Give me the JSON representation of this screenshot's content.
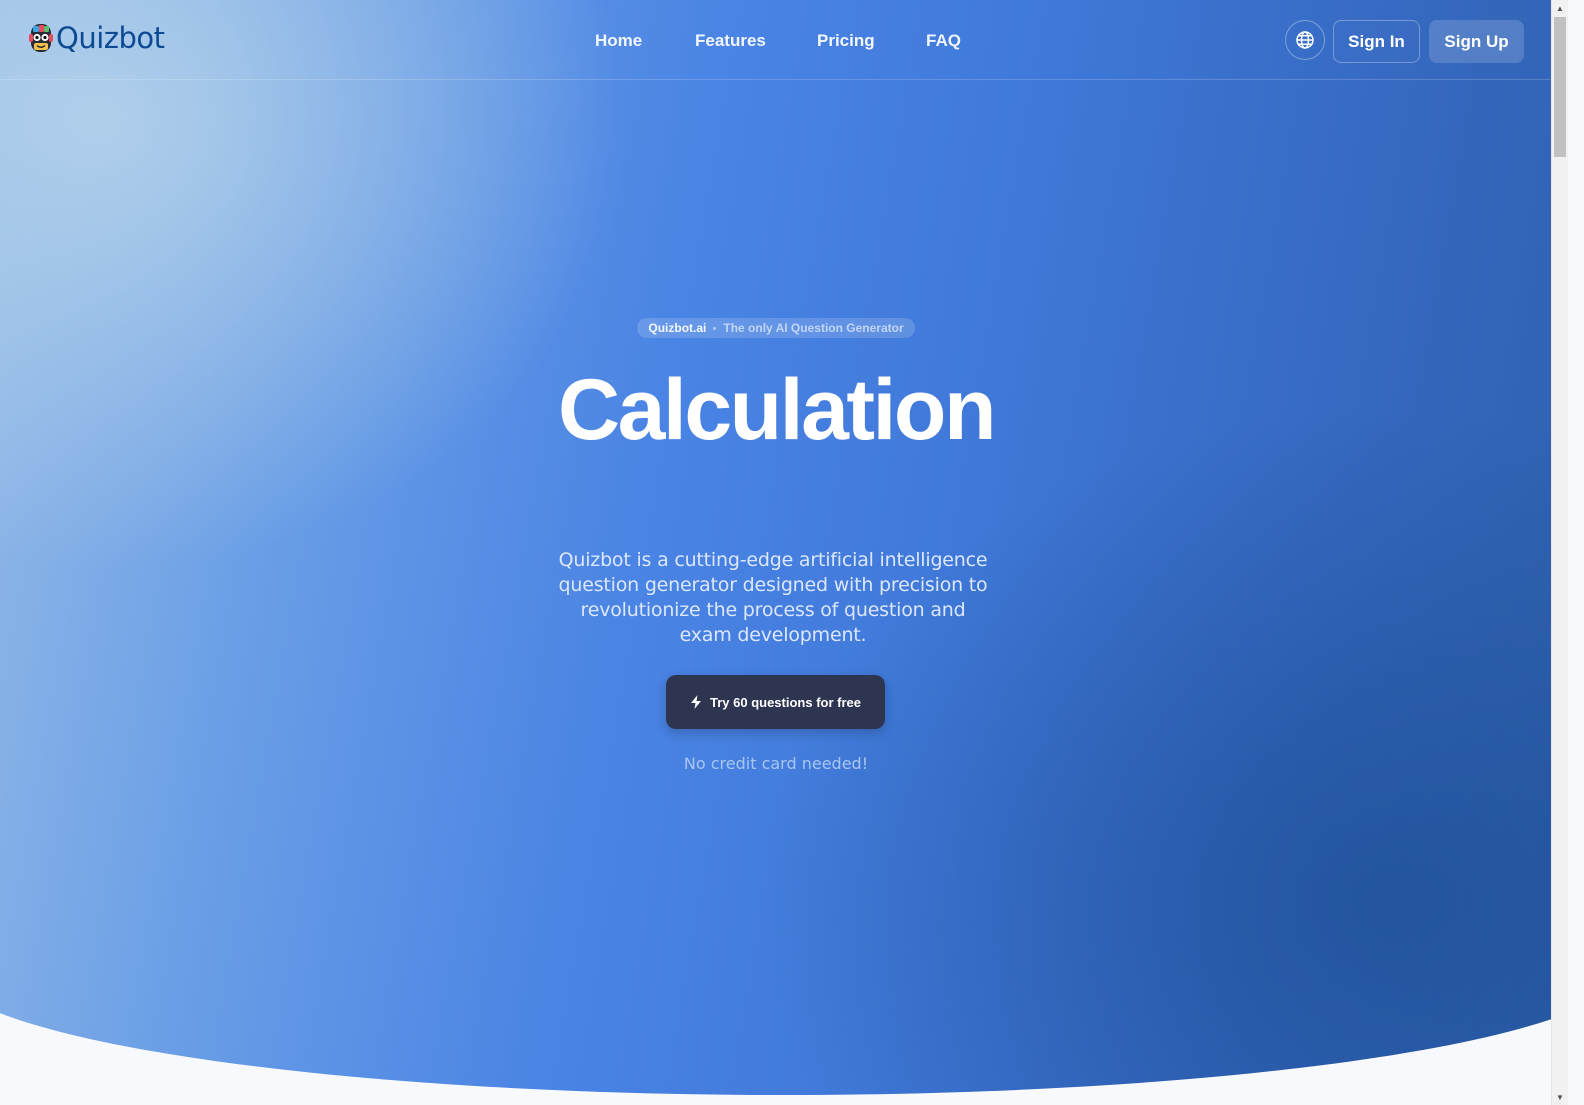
{
  "nav": {
    "logo_text": "Quizbot",
    "links": [
      {
        "label": "Home"
      },
      {
        "label": "Features"
      },
      {
        "label": "Pricing"
      },
      {
        "label": "FAQ"
      }
    ],
    "language_icon": "globe-icon",
    "sign_in_label": "Sign In",
    "sign_up_label": "Sign Up"
  },
  "hero": {
    "badge": {
      "brand": "Quizbot.ai",
      "tagline": "The only AI Question Generator"
    },
    "headline": "Calculation",
    "description": "Quizbot is a cutting-edge artificial intelligence question generator designed with precision to revolutionize the process of question and exam development.",
    "cta_icon": "bolt-icon",
    "cta_label": "Try 60 questions for free",
    "note": "No credit card needed!"
  },
  "colors": {
    "brand_text": "#0d4a94",
    "cta_background": "#2e3550",
    "hero_gradient_start": "#9cc0e8",
    "hero_gradient_mid": "#4a84e4",
    "hero_gradient_end": "#2e5ea8",
    "page_background": "#f8f9fc"
  }
}
